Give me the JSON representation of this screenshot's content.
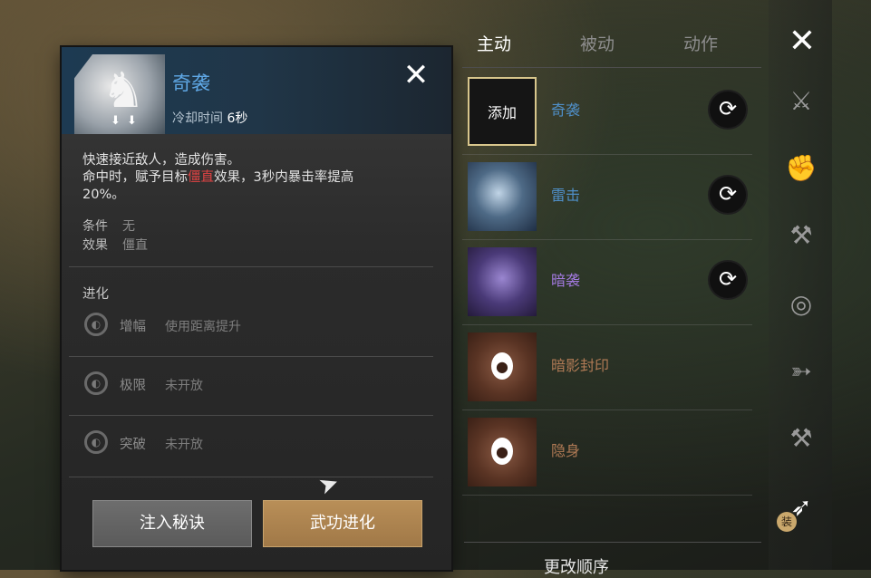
{
  "detail": {
    "title": "奇袭",
    "cooldown_label": "冷却时间",
    "cooldown_value": "6秒",
    "close_glyph": "✕",
    "desc_line1": "快速接近敌人，造成伤害。",
    "desc_line2_pre": "命中时，赋予目标",
    "desc_highlight": "僵直",
    "desc_line2_post": "效果，3秒内暴击率提高",
    "desc_line3": "20%。",
    "condition_key": "条件",
    "condition_value": "无",
    "effect_key": "效果",
    "effect_value": "僵直",
    "evolution_title": "进化",
    "evolutions": [
      {
        "name": "增幅",
        "desc": "使用距离提升"
      },
      {
        "name": "极限",
        "desc": "未开放"
      },
      {
        "name": "突破",
        "desc": "未开放"
      }
    ],
    "btn_inject": "注入秘诀",
    "btn_evolve": "武功进化",
    "highlight_color": "#e04343"
  },
  "tabs": [
    {
      "label": "主动",
      "active": true
    },
    {
      "label": "被动",
      "active": false
    },
    {
      "label": "动作",
      "active": false
    }
  ],
  "skills": [
    {
      "name": "奇袭",
      "icon_text": "添加",
      "color": "#4f8fc8",
      "swap": true
    },
    {
      "name": "雷击",
      "color": "#4f8fc8",
      "swap": true
    },
    {
      "name": "暗袭",
      "color": "#a37ae0",
      "swap": true
    },
    {
      "name": "暗影封印",
      "color": "#b07a55",
      "locked": true
    },
    {
      "name": "隐身",
      "color": "#b07a55",
      "locked": true
    }
  ],
  "reorder_label": "更改顺序",
  "rail": {
    "close_glyph": "✕",
    "equip_badge": "装",
    "weapons": [
      "sword-icon",
      "gauntlet-icon",
      "axe-icon",
      "fan-icon",
      "bow-icon",
      "hammer-icon",
      "dart-icon"
    ]
  }
}
